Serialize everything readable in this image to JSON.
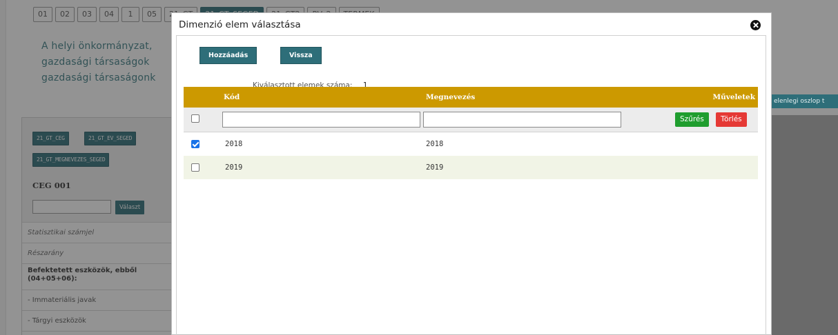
{
  "background": {
    "page_tabs": [
      "01",
      "02",
      "03",
      "04",
      "1",
      "05",
      "21_GT",
      "21_GT_SEGED",
      "21_GT2",
      "RV_2",
      "TERMEK"
    ],
    "intro_lines": [
      "A helyi önkormányzat,",
      "gazdasági társaságok",
      "gazdasági társaságonk"
    ],
    "side_panel": {
      "tags": [
        "21_GT_CEG",
        "21_GT_EV_SEGED",
        "21_GT_MEGNEVEZES_SEGED"
      ],
      "ceg_label": "CEG 001",
      "select_button": "Választ",
      "rows": [
        {
          "label": "Statisztikai számjel",
          "style": "italic"
        },
        {
          "label": "Részarány",
          "style": "italic"
        },
        {
          "label": "Befektetett eszközök, ebből (04+05+06):",
          "style": "bold"
        },
        {
          "label": "- Immateriális javak",
          "style": "normal"
        },
        {
          "label": "- Tárgyi eszközök",
          "style": "normal"
        }
      ]
    },
    "right_chip": "elenlegi oszlop t"
  },
  "modal": {
    "title": "Dimenzió elem választása",
    "add_button": "Hozzáadás",
    "back_button": "Vissza",
    "selected_count_label": "Kiválasztott elemek száma:",
    "selected_count_value": "1",
    "table": {
      "headers": {
        "code": "Kód",
        "name": "Megnevezés",
        "actions": "Műveletek"
      },
      "filter": {
        "code_value": "",
        "name_value": "",
        "filter_button": "Szűrés",
        "clear_button": "Törlés"
      },
      "rows": [
        {
          "checked": true,
          "code": "2018",
          "name": "2018"
        },
        {
          "checked": false,
          "code": "2019",
          "name": "2019"
        }
      ]
    }
  },
  "colors": {
    "teal": "#2e6e79",
    "header_gold": "#cc9900",
    "filter_green": "#1f9d2e",
    "clear_red": "#e53935",
    "overlay": "rgba(40,40,40,0.5)"
  }
}
